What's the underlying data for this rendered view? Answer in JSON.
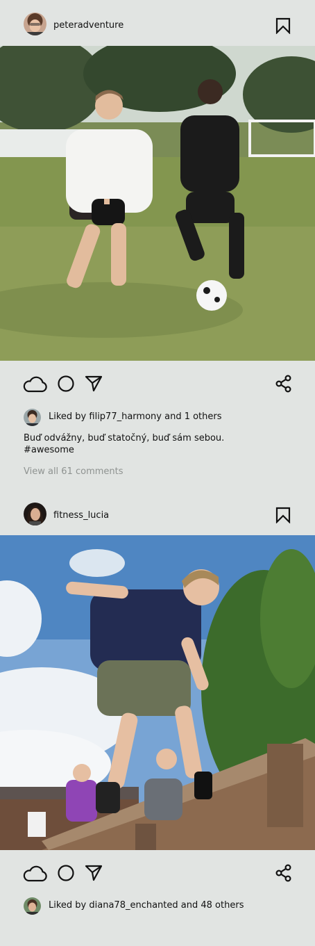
{
  "posts": [
    {
      "username": "peteradventure",
      "photo_alt": "Boys playing football on a grass field",
      "likes": {
        "prefix": "Liked by",
        "user": "filip77_harmony",
        "suffix": "and 1 others"
      },
      "caption": "Buď odvážny, buď statočný, buď sám sebou.",
      "hashtag": "#awesome",
      "comments_link": "View all 61 comments"
    },
    {
      "username": "fitness_lucia",
      "photo_alt": "Boy jumping off a wooden platform under a blue sky",
      "likes": {
        "prefix": "Liked by",
        "user": "diana78_enchanted",
        "suffix": "and 48 others"
      }
    }
  ],
  "icons": {
    "like": "cloud-icon",
    "comment": "circle-icon",
    "send": "send-icon",
    "share": "share-icon",
    "save": "bookmark-icon"
  },
  "colors": {
    "background": "#e1e4e2",
    "text": "#111111",
    "muted": "#8f9391"
  }
}
